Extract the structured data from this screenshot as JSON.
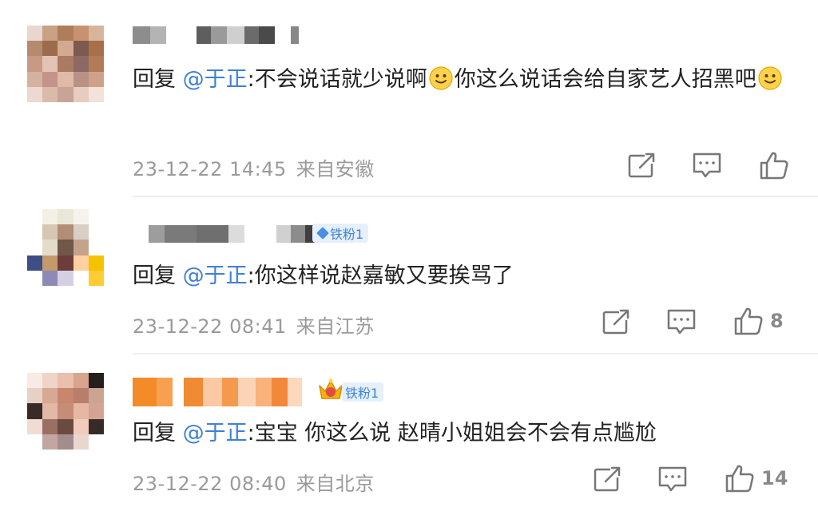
{
  "comments": [
    {
      "reply_prefix": "回复",
      "mention": "@于正",
      "colon": ":",
      "text_a": "不会说话就少说啊",
      "text_b": "你这么说话会给自家艺人招黑吧",
      "timestamp": "23-12-22 14:45",
      "location": "来自安徽",
      "likes": "",
      "icons": [
        "share-icon",
        "comment-icon",
        "like-icon"
      ]
    },
    {
      "reply_prefix": "回复",
      "mention": "@于正",
      "colon": ":",
      "text": "你这样说赵嘉敏又要挨骂了",
      "badge": "铁粉1",
      "timestamp": "23-12-22 08:41",
      "location": "来自江苏",
      "likes": "8",
      "icons": [
        "share-icon",
        "comment-icon",
        "like-icon"
      ]
    },
    {
      "reply_prefix": "回复",
      "mention": "@于正",
      "colon": ":",
      "text": "宝宝 你这么说 赵晴小姐姐会不会有点尴尬",
      "badge": "铁粉1",
      "timestamp": "23-12-22 08:40",
      "location": "来自北京",
      "likes": "14",
      "icons": [
        "share-icon",
        "comment-icon",
        "like-icon"
      ]
    }
  ],
  "colors": {
    "mention": "#3e80d6",
    "meta": "#9a9a9a",
    "badge_bg": "#e6f0fc",
    "badge_text": "#3e84d3"
  }
}
